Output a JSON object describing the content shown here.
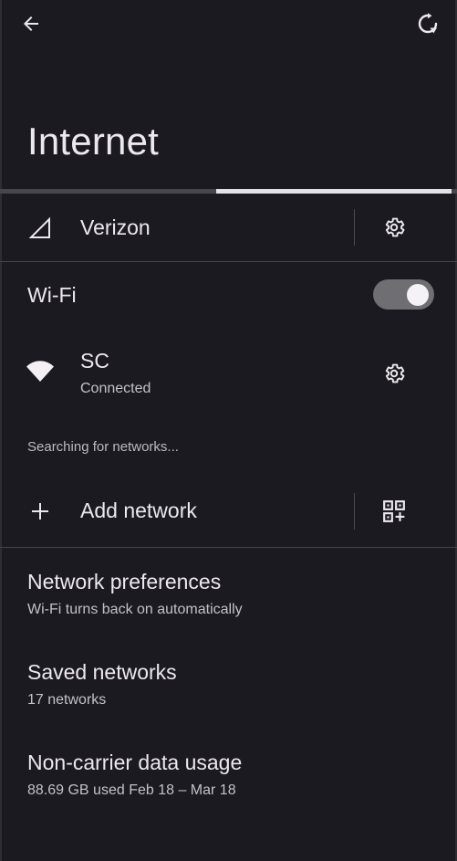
{
  "header": {
    "back_icon": "arrow-back-icon",
    "reset_icon": "network-reset-icon",
    "title": "Internet"
  },
  "colors": {
    "background": "#1b1a20",
    "text_primary": "#ece8ee",
    "text_secondary": "#c4c0c9",
    "divider": "#45444a",
    "switch_track": "#6e6e73",
    "switch_knob": "#f4f2f6"
  },
  "mobile": {
    "carrier": "Verizon",
    "signal_icon": "cellular-signal-icon",
    "settings_icon": "gear-icon"
  },
  "wifi": {
    "label": "Wi-Fi",
    "enabled": true,
    "connected_network": {
      "name": "SC",
      "status": "Connected",
      "icon": "wifi-icon",
      "settings_icon": "gear-icon"
    },
    "searching_text": "Searching for networks...",
    "add_network": {
      "label": "Add network",
      "icon": "plus-icon",
      "qr_icon": "qr-code-scanner-icon"
    }
  },
  "preferences": [
    {
      "title": "Network preferences",
      "subtitle": "Wi-Fi turns back on automatically"
    },
    {
      "title": "Saved networks",
      "subtitle": "17 networks"
    },
    {
      "title": "Non-carrier data usage",
      "subtitle": "88.69 GB used Feb 18 – Mar 18"
    }
  ]
}
